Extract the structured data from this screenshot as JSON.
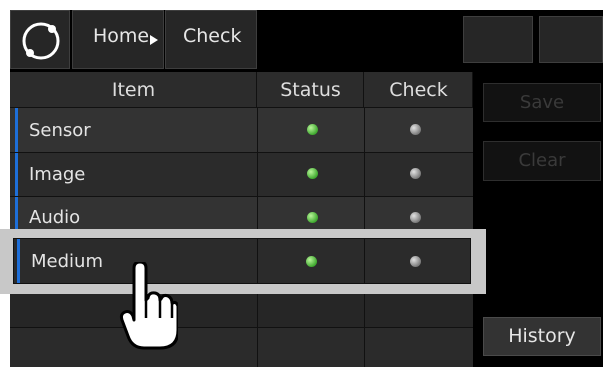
{
  "header": {
    "breadcrumb_home": "Home",
    "breadcrumb_current": "Check"
  },
  "table": {
    "columns": [
      "Item",
      "Status",
      "Check"
    ],
    "rows": [
      {
        "label": "Sensor",
        "status": "green",
        "check": "gray"
      },
      {
        "label": "Image",
        "status": "green",
        "check": "gray"
      },
      {
        "label": "Audio",
        "status": "green",
        "check": "gray"
      },
      {
        "label": "Medium",
        "status": "green",
        "check": "gray"
      }
    ]
  },
  "side_buttons": {
    "save": "Save",
    "clear": "Clear",
    "history": "History"
  },
  "colors": {
    "accent": "#1e6fd9",
    "status_on": "#3ea82e",
    "check_off": "#8a8a8a",
    "highlight_frame": "#c8c8c8"
  }
}
